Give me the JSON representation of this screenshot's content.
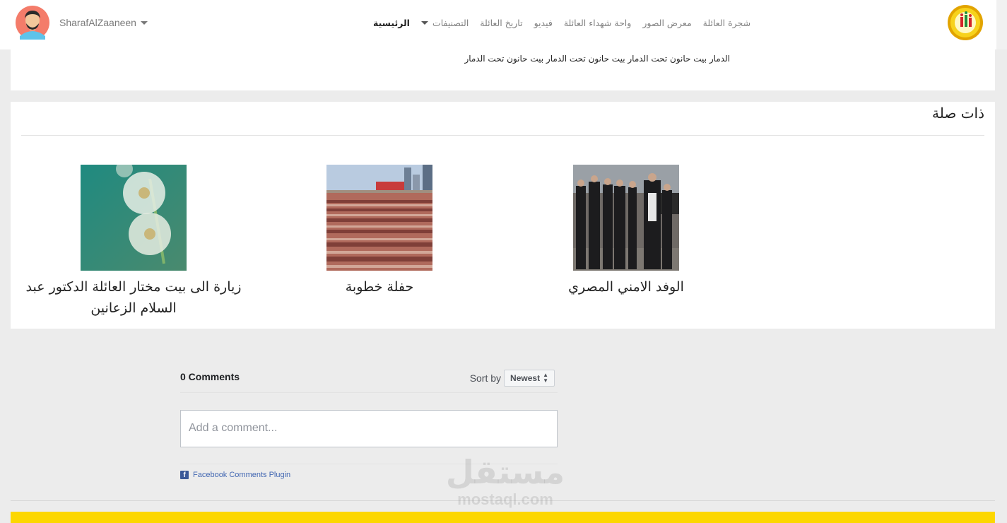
{
  "navbar": {
    "username": "SharafAlZaaneen",
    "links": [
      {
        "label": "الرئيسية",
        "active": true,
        "dropdown": false
      },
      {
        "label": "التصنيفات",
        "active": false,
        "dropdown": true
      },
      {
        "label": "تاريخ العائلة",
        "active": false,
        "dropdown": false
      },
      {
        "label": "فيديو",
        "active": false,
        "dropdown": false
      },
      {
        "label": "واحة شهداء العائلة",
        "active": false,
        "dropdown": false
      },
      {
        "label": "معرض الصور",
        "active": false,
        "dropdown": false
      },
      {
        "label": "شجرة العائلة",
        "active": false,
        "dropdown": false
      }
    ]
  },
  "article": {
    "tags_line": "الدمار بيت حانون تحت الدمار بيت حانون تحت الدمار بيت حانون تحت الدمار"
  },
  "related": {
    "title": "ذات صلة",
    "items": [
      {
        "caption": "الوفد الامني المصري",
        "image": "group-of-men-photo"
      },
      {
        "caption": "حفلة خطوبة",
        "image": "crowd-photo"
      },
      {
        "caption": "زيارة الى بيت مختار العائلة الدكتور عبد السلام الزعانين",
        "image": "dandelion-photo"
      }
    ]
  },
  "comments": {
    "count_label": "0 Comments",
    "sort_label": "Sort by",
    "sort_value": "Newest",
    "input_placeholder": "Add a comment...",
    "plugin_label": "Facebook Comments Plugin"
  },
  "watermark": {
    "arabic": "مستقل",
    "latin": "mostaql.com"
  },
  "colors": {
    "footer_bar": "#fcd700",
    "page_bg": "#ececec",
    "facebook_blue": "#4267b2"
  }
}
